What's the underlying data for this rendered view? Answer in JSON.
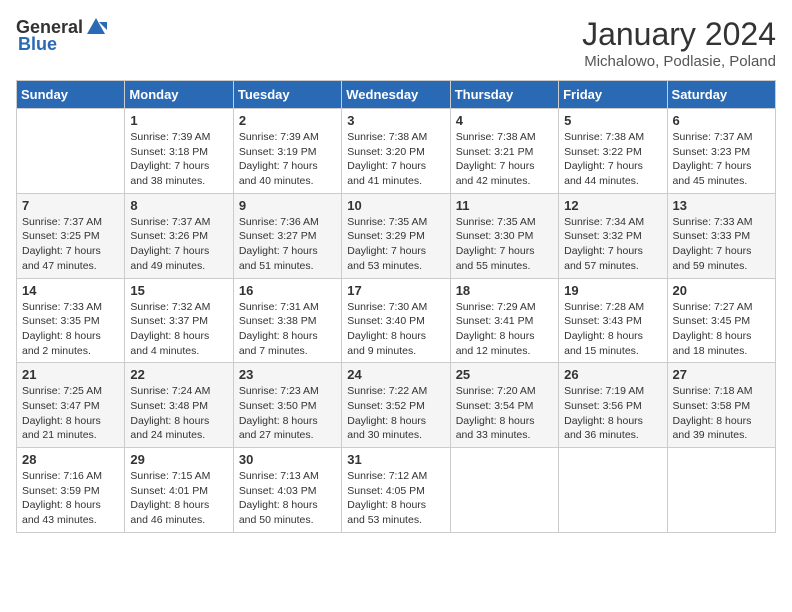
{
  "logo": {
    "general": "General",
    "blue": "Blue"
  },
  "title": "January 2024",
  "location": "Michalowo, Podlasie, Poland",
  "weekdays": [
    "Sunday",
    "Monday",
    "Tuesday",
    "Wednesday",
    "Thursday",
    "Friday",
    "Saturday"
  ],
  "weeks": [
    [
      {
        "day": "",
        "sunrise": "",
        "sunset": "",
        "daylight": ""
      },
      {
        "day": "1",
        "sunrise": "Sunrise: 7:39 AM",
        "sunset": "Sunset: 3:18 PM",
        "daylight": "Daylight: 7 hours and 38 minutes."
      },
      {
        "day": "2",
        "sunrise": "Sunrise: 7:39 AM",
        "sunset": "Sunset: 3:19 PM",
        "daylight": "Daylight: 7 hours and 40 minutes."
      },
      {
        "day": "3",
        "sunrise": "Sunrise: 7:38 AM",
        "sunset": "Sunset: 3:20 PM",
        "daylight": "Daylight: 7 hours and 41 minutes."
      },
      {
        "day": "4",
        "sunrise": "Sunrise: 7:38 AM",
        "sunset": "Sunset: 3:21 PM",
        "daylight": "Daylight: 7 hours and 42 minutes."
      },
      {
        "day": "5",
        "sunrise": "Sunrise: 7:38 AM",
        "sunset": "Sunset: 3:22 PM",
        "daylight": "Daylight: 7 hours and 44 minutes."
      },
      {
        "day": "6",
        "sunrise": "Sunrise: 7:37 AM",
        "sunset": "Sunset: 3:23 PM",
        "daylight": "Daylight: 7 hours and 45 minutes."
      }
    ],
    [
      {
        "day": "7",
        "sunrise": "Sunrise: 7:37 AM",
        "sunset": "Sunset: 3:25 PM",
        "daylight": "Daylight: 7 hours and 47 minutes."
      },
      {
        "day": "8",
        "sunrise": "Sunrise: 7:37 AM",
        "sunset": "Sunset: 3:26 PM",
        "daylight": "Daylight: 7 hours and 49 minutes."
      },
      {
        "day": "9",
        "sunrise": "Sunrise: 7:36 AM",
        "sunset": "Sunset: 3:27 PM",
        "daylight": "Daylight: 7 hours and 51 minutes."
      },
      {
        "day": "10",
        "sunrise": "Sunrise: 7:35 AM",
        "sunset": "Sunset: 3:29 PM",
        "daylight": "Daylight: 7 hours and 53 minutes."
      },
      {
        "day": "11",
        "sunrise": "Sunrise: 7:35 AM",
        "sunset": "Sunset: 3:30 PM",
        "daylight": "Daylight: 7 hours and 55 minutes."
      },
      {
        "day": "12",
        "sunrise": "Sunrise: 7:34 AM",
        "sunset": "Sunset: 3:32 PM",
        "daylight": "Daylight: 7 hours and 57 minutes."
      },
      {
        "day": "13",
        "sunrise": "Sunrise: 7:33 AM",
        "sunset": "Sunset: 3:33 PM",
        "daylight": "Daylight: 7 hours and 59 minutes."
      }
    ],
    [
      {
        "day": "14",
        "sunrise": "Sunrise: 7:33 AM",
        "sunset": "Sunset: 3:35 PM",
        "daylight": "Daylight: 8 hours and 2 minutes."
      },
      {
        "day": "15",
        "sunrise": "Sunrise: 7:32 AM",
        "sunset": "Sunset: 3:37 PM",
        "daylight": "Daylight: 8 hours and 4 minutes."
      },
      {
        "day": "16",
        "sunrise": "Sunrise: 7:31 AM",
        "sunset": "Sunset: 3:38 PM",
        "daylight": "Daylight: 8 hours and 7 minutes."
      },
      {
        "day": "17",
        "sunrise": "Sunrise: 7:30 AM",
        "sunset": "Sunset: 3:40 PM",
        "daylight": "Daylight: 8 hours and 9 minutes."
      },
      {
        "day": "18",
        "sunrise": "Sunrise: 7:29 AM",
        "sunset": "Sunset: 3:41 PM",
        "daylight": "Daylight: 8 hours and 12 minutes."
      },
      {
        "day": "19",
        "sunrise": "Sunrise: 7:28 AM",
        "sunset": "Sunset: 3:43 PM",
        "daylight": "Daylight: 8 hours and 15 minutes."
      },
      {
        "day": "20",
        "sunrise": "Sunrise: 7:27 AM",
        "sunset": "Sunset: 3:45 PM",
        "daylight": "Daylight: 8 hours and 18 minutes."
      }
    ],
    [
      {
        "day": "21",
        "sunrise": "Sunrise: 7:25 AM",
        "sunset": "Sunset: 3:47 PM",
        "daylight": "Daylight: 8 hours and 21 minutes."
      },
      {
        "day": "22",
        "sunrise": "Sunrise: 7:24 AM",
        "sunset": "Sunset: 3:48 PM",
        "daylight": "Daylight: 8 hours and 24 minutes."
      },
      {
        "day": "23",
        "sunrise": "Sunrise: 7:23 AM",
        "sunset": "Sunset: 3:50 PM",
        "daylight": "Daylight: 8 hours and 27 minutes."
      },
      {
        "day": "24",
        "sunrise": "Sunrise: 7:22 AM",
        "sunset": "Sunset: 3:52 PM",
        "daylight": "Daylight: 8 hours and 30 minutes."
      },
      {
        "day": "25",
        "sunrise": "Sunrise: 7:20 AM",
        "sunset": "Sunset: 3:54 PM",
        "daylight": "Daylight: 8 hours and 33 minutes."
      },
      {
        "day": "26",
        "sunrise": "Sunrise: 7:19 AM",
        "sunset": "Sunset: 3:56 PM",
        "daylight": "Daylight: 8 hours and 36 minutes."
      },
      {
        "day": "27",
        "sunrise": "Sunrise: 7:18 AM",
        "sunset": "Sunset: 3:58 PM",
        "daylight": "Daylight: 8 hours and 39 minutes."
      }
    ],
    [
      {
        "day": "28",
        "sunrise": "Sunrise: 7:16 AM",
        "sunset": "Sunset: 3:59 PM",
        "daylight": "Daylight: 8 hours and 43 minutes."
      },
      {
        "day": "29",
        "sunrise": "Sunrise: 7:15 AM",
        "sunset": "Sunset: 4:01 PM",
        "daylight": "Daylight: 8 hours and 46 minutes."
      },
      {
        "day": "30",
        "sunrise": "Sunrise: 7:13 AM",
        "sunset": "Sunset: 4:03 PM",
        "daylight": "Daylight: 8 hours and 50 minutes."
      },
      {
        "day": "31",
        "sunrise": "Sunrise: 7:12 AM",
        "sunset": "Sunset: 4:05 PM",
        "daylight": "Daylight: 8 hours and 53 minutes."
      },
      {
        "day": "",
        "sunrise": "",
        "sunset": "",
        "daylight": ""
      },
      {
        "day": "",
        "sunrise": "",
        "sunset": "",
        "daylight": ""
      },
      {
        "day": "",
        "sunrise": "",
        "sunset": "",
        "daylight": ""
      }
    ]
  ]
}
